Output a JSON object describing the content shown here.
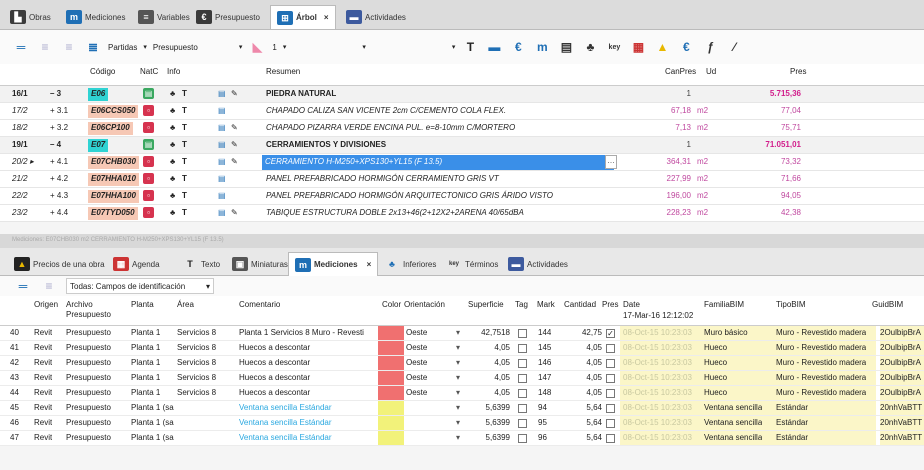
{
  "top_tabs": [
    "Obras",
    "Mediciones",
    "Variables",
    "Presupuesto",
    "Árbol",
    "Actividades"
  ],
  "top_icon_label": "key",
  "toolbar": {
    "partidas": "Partidas",
    "presupuesto": "Presupuesto",
    "level": "1"
  },
  "tree_headers": {
    "codigo": "Código",
    "natc": "NatC",
    "info": "Info",
    "resumen": "Resumen",
    "canpres": "CanPres",
    "ud": "Ud",
    "pres": "Pres"
  },
  "tree_rows": [
    {
      "num": "16/1",
      "idx": "– 3",
      "code": "E06",
      "resumen": "PIEDRA NATURAL",
      "can": "1",
      "ud": "",
      "pres": "5.715,36",
      "kind": "chapter"
    },
    {
      "num": "17/2",
      "idx": "+ 3.1",
      "code": "E06CCS050",
      "resumen": "CHAPADO CALIZA SAN VICENTE 2cm C/CEMENTO COLA FLEX.",
      "can": "67,18",
      "ud": "m2",
      "pres": "77,04",
      "kind": "item"
    },
    {
      "num": "18/2",
      "idx": "+ 3.2",
      "code": "E06CP100",
      "resumen": "CHAPADO PIZARRA VERDE ENCINA PUL. e=8-10mm C/MORTERO",
      "can": "7,13",
      "ud": "m2",
      "pres": "75,71",
      "kind": "item"
    },
    {
      "num": "19/1",
      "idx": "– 4",
      "code": "E07",
      "resumen": "CERRAMIENTOS Y DIVISIONES",
      "can": "1",
      "ud": "",
      "pres": "71.051,01",
      "kind": "chapter"
    },
    {
      "num": "20/2 ▸",
      "idx": "+ 4.1",
      "code": "E07CHB030",
      "resumen": "CERRAMIENTO H-M250+XPS130+YL15 (F 13.5)",
      "can": "364,31",
      "ud": "m2",
      "pres": "73,32",
      "kind": "selected"
    },
    {
      "num": "21/2",
      "idx": "+ 4.2",
      "code": "E07HHA010",
      "resumen": "PANEL PREFABRICADO HORMIGÓN CERRAMIENTO GRIS VT",
      "can": "227,99",
      "ud": "m2",
      "pres": "71,66",
      "kind": "item"
    },
    {
      "num": "22/2",
      "idx": "+ 4.3",
      "code": "E07HHA100",
      "resumen": "PANEL PREFABRICADO HORMIGÓN ARQUITECTONICO GRIS ÁRIDO VISTO",
      "can": "196,00",
      "ud": "m2",
      "pres": "94,05",
      "kind": "item"
    },
    {
      "num": "23/2",
      "idx": "+ 4.4",
      "code": "E07TYD050",
      "resumen": "TABIQUE ESTRUCTURA DOBLE 2x13+46(2+12X2+2ARENA 40/65dBA",
      "can": "228,23",
      "ud": "m2",
      "pres": "42,38",
      "kind": "item"
    }
  ],
  "status_text": "Mediciones: E07CHB030 m2 CERRAMIENTO H-M250+XPS130+YL15 (F 13.5)",
  "bottom_tabs": [
    "Precios de una obra",
    "Agenda",
    "Texto",
    "Miniaturas",
    "Mediciones",
    "Inferiores",
    "Términos",
    "Actividades"
  ],
  "campos_select": "Todas: Campos de identificación",
  "grid_headers": {
    "origen": "Origen",
    "archivo": "Archivo Presupuesto",
    "planta": "Planta",
    "area": "Área",
    "comentario": "Comentario",
    "color": "Color",
    "orientacion": "Orientación",
    "superficie": "Superficie",
    "tag": "Tag",
    "mark": "Mark",
    "cantidad": "Cantidad",
    "pres": "Pres",
    "date": "Date",
    "date_sub": "17-Mar-16 12:12:02",
    "familia": "FamiliaBIM",
    "tipo": "TipoBIM",
    "guid": "GuidBIM"
  },
  "grid_rows": [
    {
      "n": "40",
      "origen": "Revit",
      "archivo": "Presupuesto",
      "planta": "Planta 1",
      "area": "Servicios 8",
      "comentario": "Planta 1 Servicios 8 Muro - Revesti",
      "color": "#f07070",
      "orient": "Oeste",
      "sup": "42,7518",
      "mark": "144",
      "cant": "42,75",
      "pres": "✓",
      "date": "08-Oct-15 10:23:03",
      "familia": "Muro básico",
      "tipo": "Muro - Revestido madera",
      "guid": "2OulbipBrA"
    },
    {
      "n": "41",
      "origen": "Revit",
      "archivo": "Presupuesto",
      "planta": "Planta 1",
      "area": "Servicios 8",
      "comentario": "Huecos a descontar",
      "color": "#f07070",
      "orient": "Oeste",
      "sup": "4,05",
      "mark": "145",
      "cant": "4,05",
      "pres": "",
      "date": "08-Oct-15 10:23:03",
      "familia": "Hueco",
      "tipo": "Muro - Revestido madera",
      "guid": "2OulbipBrA"
    },
    {
      "n": "42",
      "origen": "Revit",
      "archivo": "Presupuesto",
      "planta": "Planta 1",
      "area": "Servicios 8",
      "comentario": "Huecos a descontar",
      "color": "#f07070",
      "orient": "Oeste",
      "sup": "4,05",
      "mark": "146",
      "cant": "4,05",
      "pres": "",
      "date": "08-Oct-15 10:23:03",
      "familia": "Hueco",
      "tipo": "Muro - Revestido madera",
      "guid": "2OulbipBrA"
    },
    {
      "n": "43",
      "origen": "Revit",
      "archivo": "Presupuesto",
      "planta": "Planta 1",
      "area": "Servicios 8",
      "comentario": "Huecos a descontar",
      "color": "#f07070",
      "orient": "Oeste",
      "sup": "4,05",
      "mark": "147",
      "cant": "4,05",
      "pres": "",
      "date": "08-Oct-15 10:23:03",
      "familia": "Hueco",
      "tipo": "Muro - Revestido madera",
      "guid": "2OulbipBrA"
    },
    {
      "n": "44",
      "origen": "Revit",
      "archivo": "Presupuesto",
      "planta": "Planta 1",
      "area": "Servicios 8",
      "comentario": "Huecos a descontar",
      "color": "#f07070",
      "orient": "Oeste",
      "sup": "4,05",
      "mark": "148",
      "cant": "4,05",
      "pres": "",
      "date": "08-Oct-15 10:23:03",
      "familia": "Hueco",
      "tipo": "Muro - Revestido madera",
      "guid": "2OulbipBrA"
    },
    {
      "n": "45",
      "origen": "Revit",
      "archivo": "Presupuesto",
      "planta": "Planta 1 (sa",
      "area": "",
      "comentario": "Ventana sencilla Estándar",
      "color": "#f2f27a",
      "orient": "",
      "sup": "5,6399",
      "mark": "94",
      "cant": "5,64",
      "pres": "",
      "date": "08-Oct-15 10:23:03",
      "familia": "Ventana sencilla",
      "tipo": "Estándar",
      "guid": "20nhVaBTT"
    },
    {
      "n": "46",
      "origen": "Revit",
      "archivo": "Presupuesto",
      "planta": "Planta 1 (sa",
      "area": "",
      "comentario": "Ventana sencilla Estándar",
      "color": "#f2f27a",
      "orient": "",
      "sup": "5,6399",
      "mark": "95",
      "cant": "5,64",
      "pres": "",
      "date": "08-Oct-15 10:23:03",
      "familia": "Ventana sencilla",
      "tipo": "Estándar",
      "guid": "20nhVaBTT"
    },
    {
      "n": "47",
      "origen": "Revit",
      "archivo": "Presupuesto",
      "planta": "Planta 1 (sa",
      "area": "",
      "comentario": "Ventana sencilla Estándar",
      "color": "#f2f27a",
      "orient": "",
      "sup": "5,6399",
      "mark": "96",
      "cant": "5,64",
      "pres": "",
      "date": "08-Oct-15 10:23:03",
      "familia": "Ventana sencilla",
      "tipo": "Estándar",
      "guid": "20nhVaBTT"
    }
  ]
}
